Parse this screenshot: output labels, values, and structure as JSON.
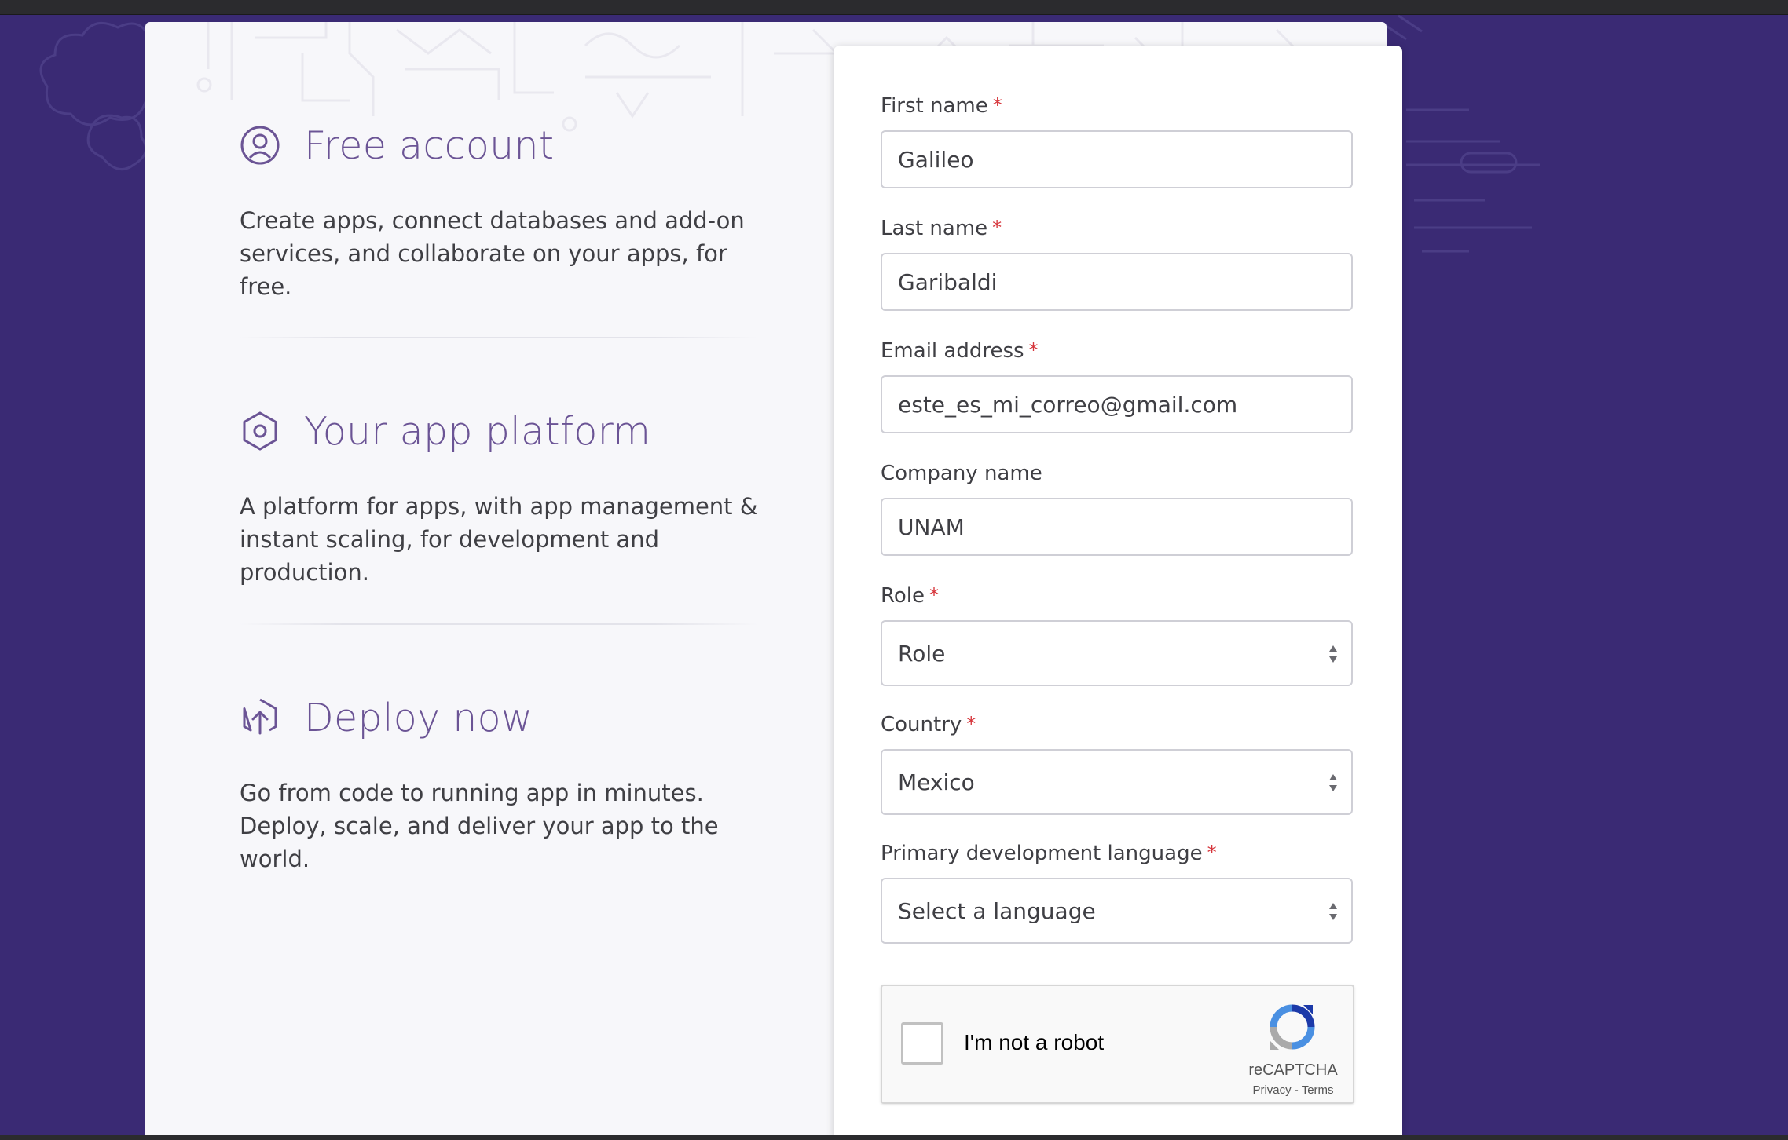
{
  "features": [
    {
      "icon": "user-icon",
      "title": "Free account",
      "description": "Create apps, connect databases and add-on services, and collaborate on your apps, for free."
    },
    {
      "icon": "hexagon-icon",
      "title": "Your app platform",
      "description": "A platform for apps, with app management & instant scaling, for development and production."
    },
    {
      "icon": "upload-icon",
      "title": "Deploy now",
      "description": "Go from code to running app in minutes. Deploy, scale, and deliver your app to the world."
    }
  ],
  "form": {
    "required_marker": "*",
    "first_name": {
      "label": "First name",
      "value": "Galileo"
    },
    "last_name": {
      "label": "Last name",
      "value": "Garibaldi"
    },
    "email": {
      "label": "Email address",
      "value": "este_es_mi_correo@gmail.com"
    },
    "company": {
      "label": "Company name",
      "value": "UNAM"
    },
    "role": {
      "label": "Role",
      "value": "Role"
    },
    "country": {
      "label": "Country",
      "value": "Mexico"
    },
    "language": {
      "label": "Primary development language",
      "value": "Select a language"
    }
  },
  "captcha": {
    "label": "I'm not a robot",
    "brand": "reCAPTCHA",
    "privacy": "Privacy",
    "separator": "-",
    "terms": "Terms"
  },
  "colors": {
    "background": "#3a2a74",
    "accent": "#6b5495",
    "required": "#d6353b"
  }
}
